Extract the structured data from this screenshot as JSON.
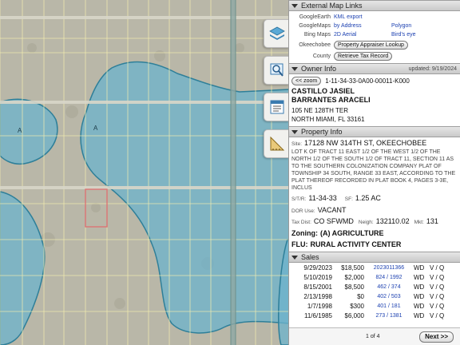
{
  "map": {
    "zone_label_1": "A",
    "zone_label_2": "A",
    "colors": {
      "land": "#b9b7a8",
      "flood": "#6cb3cc",
      "grid": "#f3eeb0",
      "road": "#8fa9a5",
      "parcel": "#e07070"
    }
  },
  "toolbar": {
    "items": [
      {
        "name": "layers-icon"
      },
      {
        "name": "search-icon"
      },
      {
        "name": "report-icon"
      },
      {
        "name": "measure-icon"
      }
    ]
  },
  "external": {
    "header": "External Map Links",
    "rows": [
      {
        "label": "GoogleEarth",
        "link1": "KML export",
        "link2": ""
      },
      {
        "label": "GoogleMaps",
        "link1": "by Address",
        "link2": "Polygon"
      },
      {
        "label": "Bing Maps",
        "link1": "2D Aerial",
        "link2": "Bird's eye"
      }
    ],
    "okeechobee_label": "Okeechobee",
    "appraiser_button": "Property Appraiser Lookup",
    "county_label": "County",
    "tax_button": "Retrieve Tax Record"
  },
  "owner": {
    "header": "Owner Info",
    "updated": "updated: 9/19/2024",
    "zoom_button": "<< zoom",
    "parcel_id": "1-11-34-33-0A00-00011-K000",
    "name1": "CASTILLO JASIEL",
    "name2": "BARRANTES ARACELI",
    "addr1": "105 NE 128TH TER",
    "addr2": "NORTH MIAMI, FL 33161"
  },
  "property": {
    "header": "Property Info",
    "site_label": "Site:",
    "site": "17128 NW 314TH ST, OKEECHOBEE",
    "legal": "LOT K OF TRACT 11 EAST 1/2 OF THE WEST 1/2 OF THE NORTH 1/2 OF THE SOUTH 1/2 OF TRACT 11, SECTION 11 AS TO THE SOUTHERN COLONIZATION COMPANY PLAT OF TOWNSHIP 34 SOUTH, RANGE 33 EAST, ACCORDING TO THE PLAT THEREOF RECORDED IN PLAT BOOK 4, PAGES 3-3E, INCLUS",
    "str_label": "S/T/R:",
    "str": "11-34-33",
    "sf_label": "SF:",
    "sf": "1.25 AC",
    "dor_label": "DOR Use:",
    "dor": "VACANT",
    "taxdist_label": "Tax Dist:",
    "taxdist": "CO SFWMD",
    "neigh_label": "Neigh:",
    "neigh": "132110.02",
    "mkt_label": "Mkt:",
    "mkt": "131",
    "zoning_label": "Zoning:",
    "zoning": "(A) AGRICULTURE",
    "flu_label": "FLU:",
    "flu": "RURAL ACTIVITY CENTER"
  },
  "sales": {
    "header": "Sales",
    "rows": [
      {
        "date": "9/29/2023",
        "price": "$18,500",
        "book": "2023011366",
        "type": "WD",
        "vq": "V / Q"
      },
      {
        "date": "5/10/2019",
        "price": "$2,000",
        "book": "824 / 1992",
        "type": "WD",
        "vq": "V / Q"
      },
      {
        "date": "8/15/2001",
        "price": "$8,500",
        "book": "462 / 374",
        "type": "WD",
        "vq": "V / Q"
      },
      {
        "date": "2/13/1998",
        "price": "$0",
        "book": "402 / 503",
        "type": "WD",
        "vq": "V / Q"
      },
      {
        "date": "1/7/1998",
        "price": "$300",
        "book": "401 / 181",
        "type": "WD",
        "vq": "V / Q"
      },
      {
        "date": "11/6/1985",
        "price": "$6,000",
        "book": "273 / 1381",
        "type": "WD",
        "vq": "V / Q"
      }
    ]
  },
  "pager": {
    "text": "1 of 4",
    "next": "Next >>"
  }
}
